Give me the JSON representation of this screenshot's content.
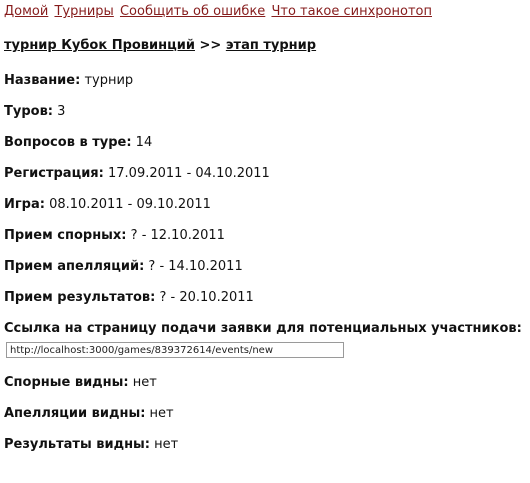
{
  "nav": {
    "home": "Домой",
    "tournaments": "Турниры",
    "report_bug": "Сообщить об ошибке",
    "about": "Что такое синхронотоп"
  },
  "breadcrumb": {
    "tournament_link": "турнир Кубок Провинций",
    "separator": ">>",
    "stage_link": "этап турнир"
  },
  "fields": {
    "name": {
      "label": "Название:",
      "value": "турнир"
    },
    "rounds": {
      "label": "Туров:",
      "value": "3"
    },
    "questions": {
      "label": "Вопросов в туре:",
      "value": "14"
    },
    "registration": {
      "label": "Регистрация:",
      "value": "17.09.2011 - 04.10.2011"
    },
    "game": {
      "label": "Игра:",
      "value": "08.10.2011 - 09.10.2011"
    },
    "disputes_intake": {
      "label": "Прием спорных:",
      "value": "? - 12.10.2011"
    },
    "appeals_intake": {
      "label": "Прием апелляций:",
      "value": "? - 14.10.2011"
    },
    "results_intake": {
      "label": "Прием результатов:",
      "value": "? - 20.10.2011"
    },
    "application_link": {
      "label": "Ссылка на страницу подачи заявки для потенциальных участников:",
      "value": "http://localhost:3000/games/839372614/events/new"
    },
    "disputes_visible": {
      "label": "Спорные видны:",
      "value": "нет"
    },
    "appeals_visible": {
      "label": "Апелляции видны:",
      "value": "нет"
    },
    "results_visible": {
      "label": "Результаты видны:",
      "value": "нет"
    }
  },
  "colors": {
    "link": "#861c1c",
    "text": "#111111"
  }
}
